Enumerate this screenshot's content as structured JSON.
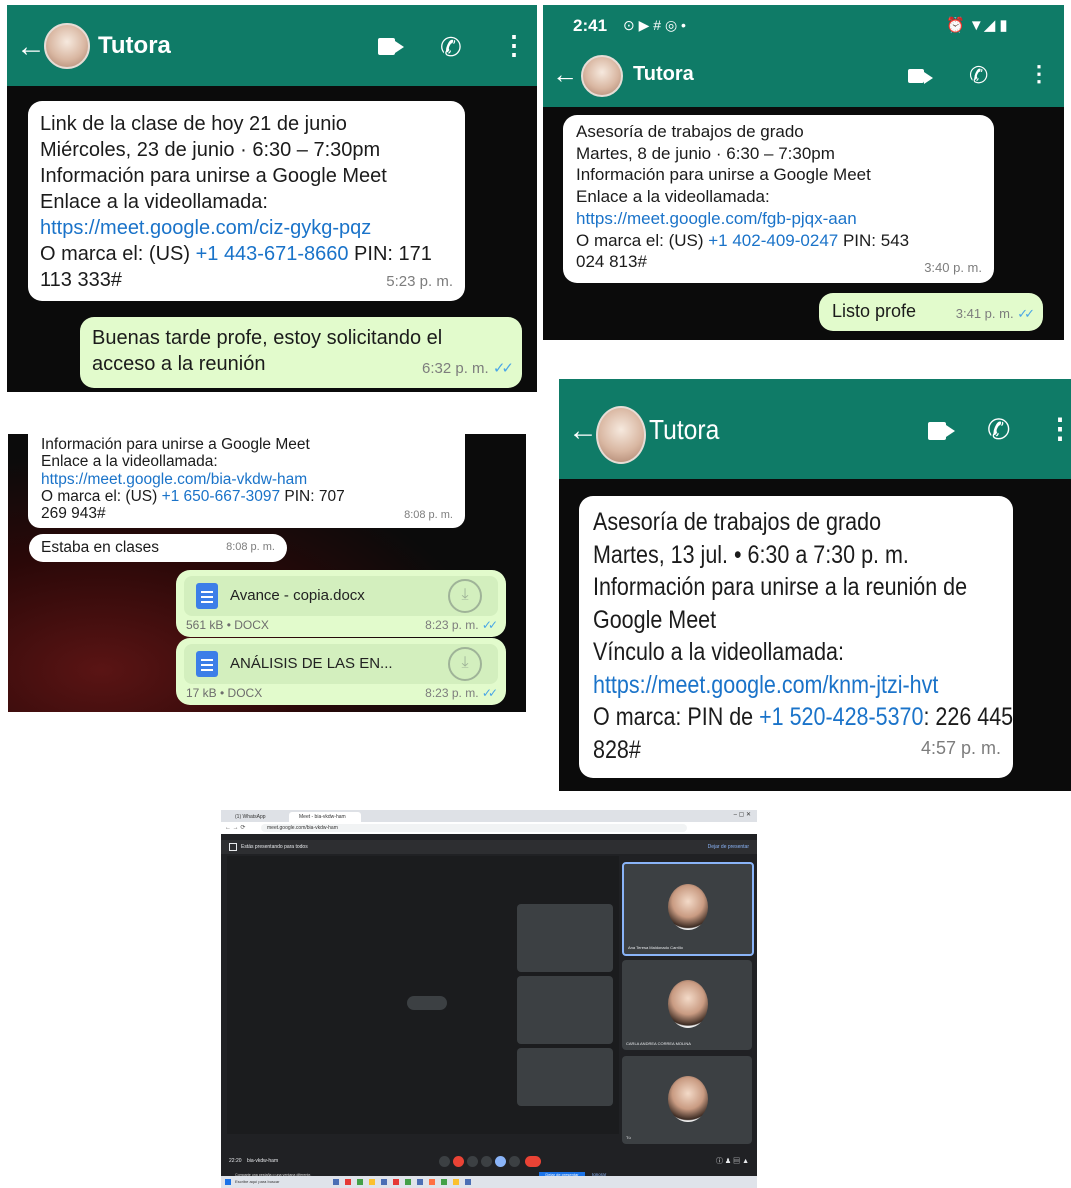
{
  "chats": {
    "c1": {
      "contact": "Tutora",
      "msg_in": [
        "Link de la clase de hoy 21 de junio",
        "Miércoles, 23 de junio · 6:30 – 7:30pm",
        "Información para unirse a Google Meet",
        "Enlace a la videollamada:",
        "https://meet.google.com/ciz-gykg-pqz",
        "O marca el: (US) ",
        "+1 443-671-8660",
        " PIN: 171",
        "113 333#"
      ],
      "msg_in_time": "5:23 p. m.",
      "msg_out": [
        "Buenas tarde profe, estoy solicitando el",
        "acceso a la reunión"
      ],
      "msg_out_time": "6:32 p. m."
    },
    "c2": {
      "status_time": "2:41",
      "status_icons": "⊙ ▶ # ◎ •",
      "status_right": "⏰ ▼◢ ▮",
      "contact": "Tutora",
      "msg_in": [
        "Asesoría de trabajos de grado",
        "Martes, 8 de junio · 6:30 – 7:30pm",
        "Información para unirse a Google Meet",
        "Enlace a la videollamada:",
        "https://meet.google.com/fgb-pjqx-aan",
        "O marca el: (US) ",
        "+1 402-409-0247",
        " PIN: 543",
        "024 813#"
      ],
      "msg_in_time": "3:40 p. m.",
      "msg_out": "Listo profe",
      "msg_out_time": "3:41 p. m."
    },
    "c3": {
      "msg_in": [
        "Información para unirse a Google Meet",
        "Enlace a la videollamada:",
        "https://meet.google.com/bia-vkdw-ham",
        "O marca el: (US) ",
        "+1 650-667-3097",
        " PIN: 707",
        "269 943#"
      ],
      "msg_in_time": "8:08 p. m.",
      "msg2": "Estaba en clases",
      "msg2_time": "8:08 p. m.",
      "doc1": {
        "name": "Avance - copia.docx",
        "meta": "561 kB • DOCX",
        "time": "8:23 p. m."
      },
      "doc2": {
        "name": "ANÁLISIS DE LAS EN...",
        "meta": "17 kB • DOCX",
        "time": "8:23 p. m."
      }
    },
    "c4": {
      "contact": "Tutora",
      "msg_in": [
        "Asesoría de trabajos de grado",
        "Martes, 13 jul.  •  6:30 a 7:30 p. m.",
        "Información para unirse a la reunión de",
        "Google Meet",
        "Vínculo a la videollamada:",
        "https://meet.google.com/knm-jtzi-hvt",
        "O marca: PIN de ",
        "+1 520-428-5370",
        ": 226 445",
        "828#"
      ],
      "msg_in_time": "4:57 p. m."
    }
  },
  "meet": {
    "tab1": "(1) WhatsApp",
    "tab2": "Meet - bia-vkdw-ham",
    "url": "meet.google.com/bia-vkdw-ham",
    "presenting": "Estás presentando para todos",
    "stop_label": "Dejar de presentar",
    "participants": [
      "Ana Teresa Maldonado Carrillo",
      "CARLA ANDREA CORREA MOLINA",
      "Tú"
    ],
    "time": "22:20",
    "meeting_code": "bia-vkdw-ham",
    "notice": "Para evitar el efecto espejo, no compartas la pantalla completa ni la ventana del navegador entero. Comparte una pestaña o una ventana diferente.",
    "ignore": "Ignorar",
    "search": "Escribe aquí para buscar"
  },
  "colors": {
    "header": "#0f7b67",
    "out_bubble": "#e2fbcc",
    "link": "#1a73c9",
    "tick": "#4aa6e6"
  }
}
